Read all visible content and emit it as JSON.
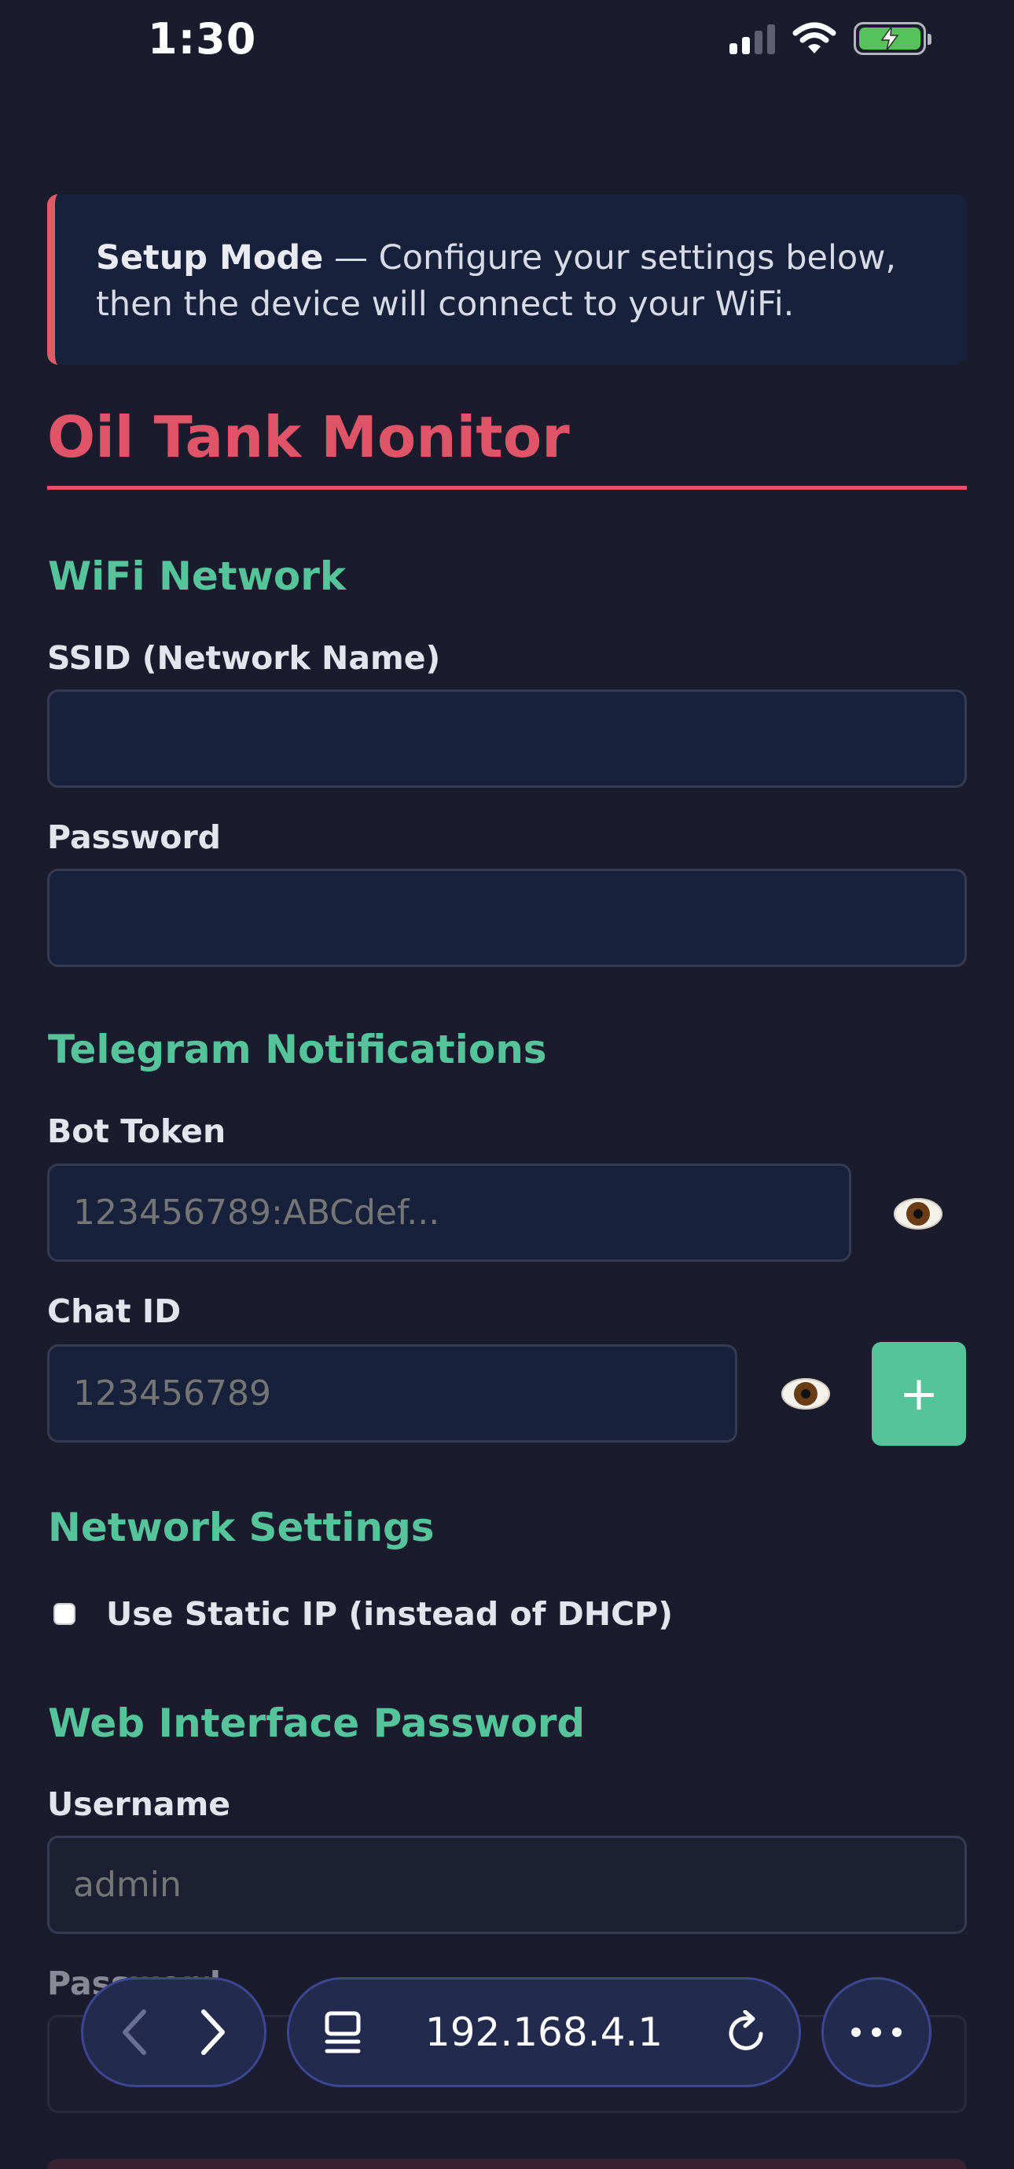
{
  "status_bar": {
    "time": "1:30"
  },
  "banner": {
    "bold_text": "Setup Mode",
    "text_line1": " — Configure your settings below,",
    "text_line2": "then the device will connect to your WiFi."
  },
  "app_title": "Oil Tank Monitor",
  "wifi": {
    "section_title": "WiFi Network",
    "ssid_label": "SSID (Network Name)",
    "ssid_value": "",
    "password_label": "Password",
    "password_value": ""
  },
  "telegram": {
    "section_title": "Telegram Notifications",
    "bot_token_label": "Bot Token",
    "bot_token_placeholder": "123456789:ABCdef...",
    "chat_id_label": "Chat ID",
    "chat_id_placeholder": "123456789",
    "add_label": "+"
  },
  "network": {
    "section_title": "Network Settings",
    "static_ip_label": "Use Static IP (instead of DHCP)"
  },
  "web_auth": {
    "section_title": "Web Interface Password",
    "username_label": "Username",
    "username_placeholder": "admin",
    "password_label": "Password"
  },
  "browser": {
    "url": "192.168.4.1"
  },
  "colors": {
    "background": "#1b1b2e",
    "accent_red": "#e05468",
    "accent_green": "#55c49a",
    "input_bg": "#17213b"
  }
}
